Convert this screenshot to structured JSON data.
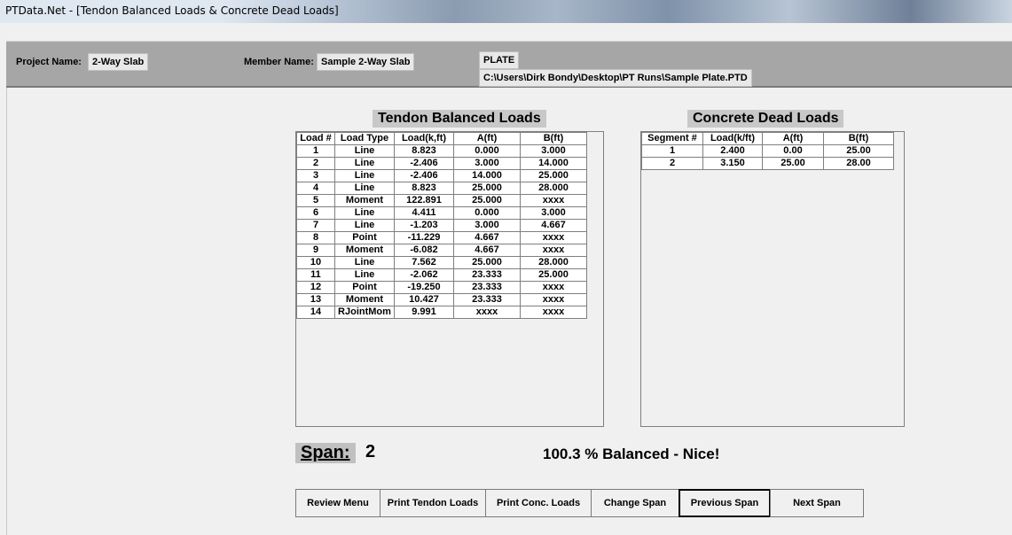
{
  "window": {
    "title": "PTData.Net - [Tendon Balanced Loads & Concrete Dead Loads]"
  },
  "header": {
    "project_label": "Project Name:",
    "project_value": "2-Way Slab",
    "member_label": "Member Name:",
    "member_value": "Sample 2-Way Slab",
    "type_value": "PLATE",
    "path_value": "C:\\Users\\Dirk Bondy\\Desktop\\PT Runs\\Sample Plate.PTD"
  },
  "tendon": {
    "title": "Tendon Balanced Loads",
    "columns": [
      "Load #",
      "Load Type",
      "Load(k,ft)",
      "A(ft)",
      "B(ft)"
    ],
    "rows": [
      [
        "1",
        "Line",
        "8.823",
        "0.000",
        "3.000"
      ],
      [
        "2",
        "Line",
        "-2.406",
        "3.000",
        "14.000"
      ],
      [
        "3",
        "Line",
        "-2.406",
        "14.000",
        "25.000"
      ],
      [
        "4",
        "Line",
        "8.823",
        "25.000",
        "28.000"
      ],
      [
        "5",
        "Moment",
        "122.891",
        "25.000",
        "xxxx"
      ],
      [
        "6",
        "Line",
        "4.411",
        "0.000",
        "3.000"
      ],
      [
        "7",
        "Line",
        "-1.203",
        "3.000",
        "4.667"
      ],
      [
        "8",
        "Point",
        "-11.229",
        "4.667",
        "xxxx"
      ],
      [
        "9",
        "Moment",
        "-6.082",
        "4.667",
        "xxxx"
      ],
      [
        "10",
        "Line",
        "7.562",
        "25.000",
        "28.000"
      ],
      [
        "11",
        "Line",
        "-2.062",
        "23.333",
        "25.000"
      ],
      [
        "12",
        "Point",
        "-19.250",
        "23.333",
        "xxxx"
      ],
      [
        "13",
        "Moment",
        "10.427",
        "23.333",
        "xxxx"
      ],
      [
        "14",
        "RJointMom",
        "9.991",
        "xxxx",
        "xxxx"
      ]
    ]
  },
  "concrete": {
    "title": "Concrete Dead Loads",
    "columns": [
      "Segment #",
      "Load(k/ft)",
      "A(ft)",
      "B(ft)"
    ],
    "rows": [
      [
        "1",
        "2.400",
        "0.00",
        "25.00"
      ],
      [
        "2",
        "3.150",
        "25.00",
        "28.00"
      ]
    ]
  },
  "span": {
    "label": "Span:",
    "value": "2"
  },
  "status": {
    "balanced_text": "100.3 % Balanced - Nice!"
  },
  "buttons": {
    "review_menu": "Review Menu",
    "print_tendon": "Print Tendon Loads",
    "print_conc": "Print Conc. Loads",
    "change_span": "Change Span",
    "previous_span": "Previous Span",
    "next_span": "Next Span"
  }
}
